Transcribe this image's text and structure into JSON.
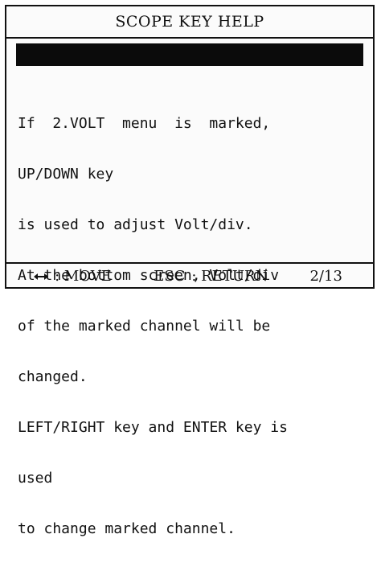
{
  "window": {
    "title": "SCOPE KEY HELP"
  },
  "help": {
    "lines": [
      "If  2.VOLT  menu  is  marked,",
      "UP/DOWN key",
      "is used to adjust Volt/div.",
      "At the bottom screen, Volt/div",
      "of the marked channel will be",
      "changed.",
      "LEFT/RIGHT key and ENTER key is",
      "used",
      "to change marked channel."
    ]
  },
  "footer": {
    "move_icon": "left-right-arrow-icon",
    "move_label": ": MOVE",
    "esc_key": "ESC",
    "esc_label": ": RETURN",
    "page": "2/13"
  },
  "colors": {
    "bar": "#0b0b0b",
    "background": "#fbfbfb",
    "text": "#111111"
  }
}
